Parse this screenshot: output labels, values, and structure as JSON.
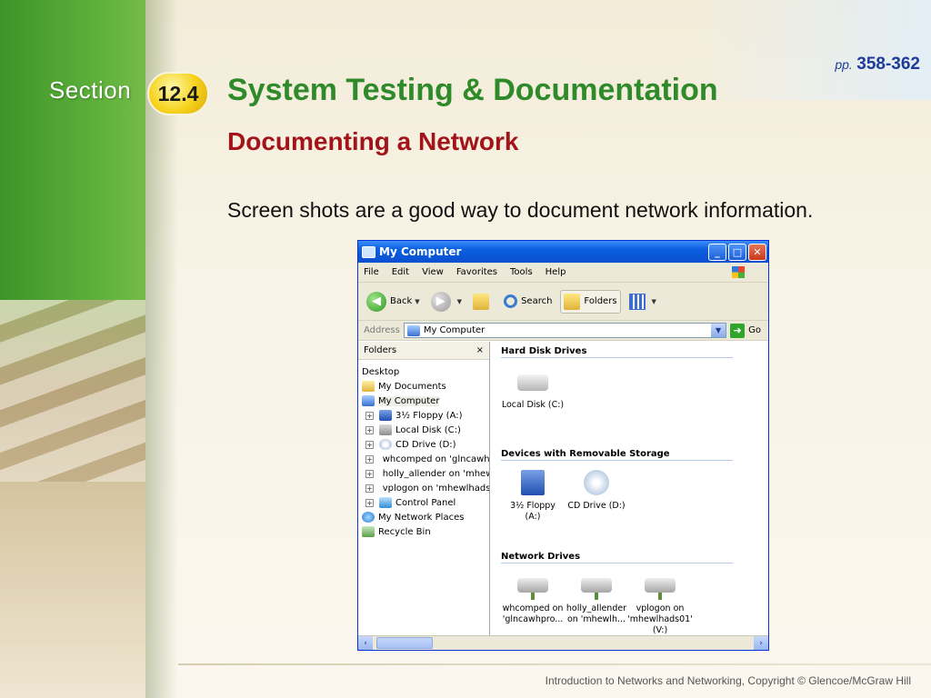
{
  "slide": {
    "section_word": "Section",
    "section_number": "12.4",
    "pages_prefix": "pp.",
    "pages_range": "358-362",
    "title": "System Testing & Documentation",
    "subtitle": "Documenting a Network",
    "body": "Screen shots are a good way to document network information.",
    "footer": "Introduction to Networks and Networking, Copyright © Glencoe/McGraw Hill",
    "colors": {
      "title": "#2f8a2a",
      "subtitle": "#a3141a",
      "sidebar": "#57ad34",
      "badge": "#f6d21b"
    }
  },
  "window": {
    "title": "My Computer",
    "menu": [
      "File",
      "Edit",
      "View",
      "Favorites",
      "Tools",
      "Help"
    ],
    "toolbar": {
      "back": "Back",
      "search": "Search",
      "folders": "Folders"
    },
    "address": {
      "label": "Address",
      "value": "My Computer",
      "go": "Go"
    },
    "folders_pane": {
      "title": "Folders",
      "close": "×",
      "tree": [
        {
          "label": "Desktop",
          "icon": "none",
          "expand": false,
          "indent": 0
        },
        {
          "label": "My Documents",
          "icon": "docs",
          "expand": false,
          "indent": 0
        },
        {
          "label": "My Computer",
          "icon": "comp",
          "expand": false,
          "indent": 0,
          "selected": true
        },
        {
          "label": "3½ Floppy (A:)",
          "icon": "floppy",
          "expand": true,
          "indent": 1
        },
        {
          "label": "Local Disk (C:)",
          "icon": "drive",
          "expand": true,
          "indent": 1
        },
        {
          "label": "CD Drive (D:)",
          "icon": "cd",
          "expand": true,
          "indent": 1
        },
        {
          "label": "whcomped on 'glncawh",
          "icon": "net",
          "expand": true,
          "indent": 1
        },
        {
          "label": "holly_allender on 'mhew",
          "icon": "net",
          "expand": true,
          "indent": 1
        },
        {
          "label": "vplogon on 'mhewlhads",
          "icon": "net",
          "expand": true,
          "indent": 1
        },
        {
          "label": "Control Panel",
          "icon": "panel",
          "expand": true,
          "indent": 1
        },
        {
          "label": "My Network Places",
          "icon": "globe",
          "expand": false,
          "indent": 0
        },
        {
          "label": "Recycle Bin",
          "icon": "bin",
          "expand": false,
          "indent": 0
        }
      ]
    },
    "groups": [
      {
        "heading": "Hard Disk Drives",
        "items": [
          {
            "lines": [
              "Local Disk (C:)"
            ],
            "icon": "drive"
          }
        ]
      },
      {
        "heading": "Devices with Removable Storage",
        "items": [
          {
            "lines": [
              "3½ Floppy",
              "(A:)"
            ],
            "icon": "floppy"
          },
          {
            "lines": [
              "CD Drive (D:)"
            ],
            "icon": "cd"
          }
        ]
      },
      {
        "heading": "Network Drives",
        "items": [
          {
            "lines": [
              "whcomped on",
              "'glncawhpro..."
            ],
            "icon": "netdrive"
          },
          {
            "lines": [
              "holly_allender",
              "on 'mhewlh..."
            ],
            "icon": "netdrive"
          },
          {
            "lines": [
              "vplogon on",
              "'mhewlhads01'",
              "(V:)"
            ],
            "icon": "netdrive"
          }
        ]
      }
    ],
    "scroll": {
      "left": "‹",
      "right": "›"
    }
  }
}
